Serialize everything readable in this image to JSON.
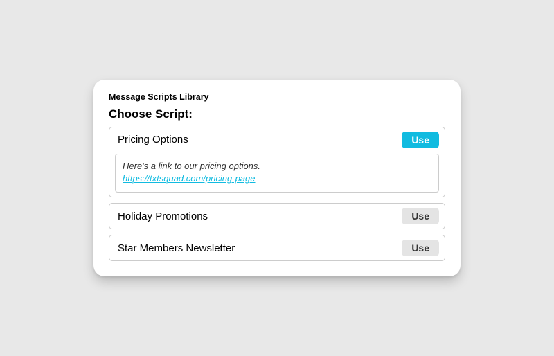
{
  "card": {
    "title": "Message Scripts Library",
    "heading": "Choose Script:"
  },
  "scripts": [
    {
      "name": "Pricing Options",
      "button_label": "Use",
      "active": true,
      "preview": {
        "text": "Here's a link to our pricing options.",
        "link": "https://txtsquad.com/pricing-page"
      }
    },
    {
      "name": "Holiday Promotions",
      "button_label": "Use",
      "active": false
    },
    {
      "name": "Star Members Newsletter",
      "button_label": "Use",
      "active": false
    }
  ]
}
